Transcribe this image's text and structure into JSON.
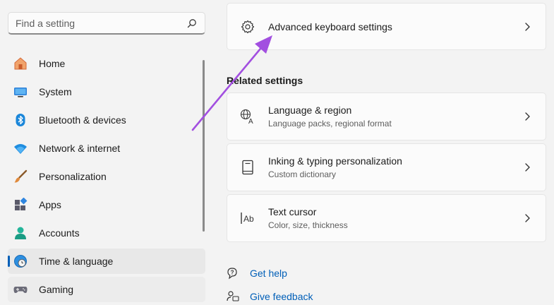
{
  "search": {
    "placeholder": "Find a setting",
    "icon": "search-icon"
  },
  "sidebar": {
    "items": [
      {
        "label": "Home",
        "icon": "home-icon"
      },
      {
        "label": "System",
        "icon": "system-icon"
      },
      {
        "label": "Bluetooth & devices",
        "icon": "bluetooth-icon"
      },
      {
        "label": "Network & internet",
        "icon": "network-icon"
      },
      {
        "label": "Personalization",
        "icon": "brush-icon"
      },
      {
        "label": "Apps",
        "icon": "apps-icon"
      },
      {
        "label": "Accounts",
        "icon": "accounts-icon"
      },
      {
        "label": "Time & language",
        "icon": "time-language-icon",
        "active": true
      },
      {
        "label": "Gaming",
        "icon": "gaming-icon"
      }
    ]
  },
  "main": {
    "advanced": {
      "title": "Advanced keyboard settings"
    },
    "related_title": "Related settings",
    "related": [
      {
        "title": "Language & region",
        "subtitle": "Language packs, regional format"
      },
      {
        "title": "Inking & typing personalization",
        "subtitle": "Custom dictionary"
      },
      {
        "title": "Text cursor",
        "subtitle": "Color, size, thickness"
      }
    ],
    "links": [
      {
        "label": "Get help"
      },
      {
        "label": "Give feedback"
      }
    ]
  },
  "colors": {
    "accent": "#005fb8",
    "annotation_arrow": "#a24fe0"
  }
}
